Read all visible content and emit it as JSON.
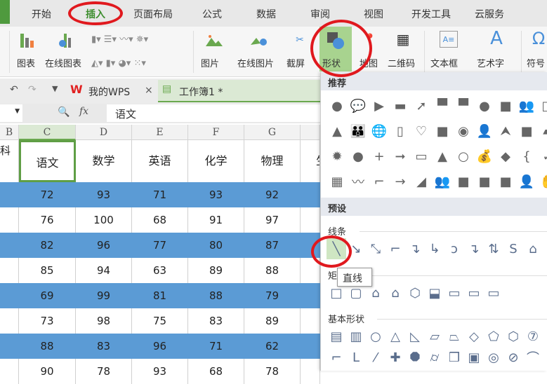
{
  "menu_tabs": [
    "开始",
    "插入",
    "页面布局",
    "公式",
    "数据",
    "审阅",
    "视图",
    "开发工具",
    "云服务"
  ],
  "active_tab": "插入",
  "ribbon": {
    "chart": "图表",
    "online_chart": "在线图表",
    "picture": "图片",
    "online_picture": "在线图片",
    "screenshot": "截屏",
    "shapes": "形状",
    "map": "地图",
    "qrcode": "二维码",
    "textbox": "文本框",
    "wordart": "艺术字",
    "symbol": "符号"
  },
  "doc_tabs": {
    "my_wps": "我的WPS",
    "workbook": "工作簿1 *"
  },
  "formula": {
    "fx": "fx",
    "value": "语文"
  },
  "columns": [
    "B",
    "C",
    "D",
    "E",
    "F",
    "G"
  ],
  "header_row": {
    "partial_b": "科",
    "cells": [
      "语文",
      "数学",
      "英语",
      "化学",
      "物理"
    ],
    "partial_h": "生"
  },
  "rows": [
    [
      "72",
      "93",
      "71",
      "93",
      "92"
    ],
    [
      "76",
      "100",
      "68",
      "91",
      "97"
    ],
    [
      "82",
      "96",
      "77",
      "80",
      "87"
    ],
    [
      "85",
      "94",
      "63",
      "89",
      "88"
    ],
    [
      "69",
      "99",
      "81",
      "88",
      "79"
    ],
    [
      "73",
      "98",
      "75",
      "83",
      "89"
    ],
    [
      "88",
      "83",
      "96",
      "71",
      "62"
    ],
    [
      "90",
      "78",
      "93",
      "68",
      "78"
    ]
  ],
  "colors": {
    "accent": "#4f9a3e",
    "band": "#5b9bd5",
    "annotation": "#e0191e"
  },
  "shapes_panel": {
    "recommended_title": "推荐",
    "recommended": [
      "●",
      "💬",
      "▶",
      "▬",
      "➚",
      "▀",
      "▀",
      "●",
      "■",
      "👥",
      "□",
      "▲",
      "👪",
      "🌐",
      "▯",
      "♡",
      "■",
      "◉",
      "👤",
      "⮝",
      "■",
      "▰",
      "✹",
      "●",
      "+",
      "➞",
      "▭",
      "▲",
      "○",
      "💰",
      "◆",
      "{",
      "✓",
      "▦",
      "〰",
      "⌐",
      "→",
      "◢",
      "👥",
      "■",
      "■",
      "■",
      "👤",
      "✋"
    ],
    "preset_title": "预设",
    "lines_label": "线条",
    "lines": [
      "╲",
      "↘",
      "⤡",
      "⌐",
      "↴",
      "↳",
      "ↄ",
      "↴",
      "⇅",
      "S",
      "⌂"
    ],
    "tooltip": "直线",
    "rect_label": "矩形",
    "rects": [
      "□",
      "▢",
      "⌂",
      "⌂",
      "⬡",
      "⬓",
      "▭",
      "▭",
      "▭"
    ],
    "basic_label": "基本形状",
    "basic": [
      "▤",
      "▥",
      "○",
      "△",
      "◺",
      "▱",
      "⏢",
      "◇",
      "⬠",
      "⬡",
      "⑦",
      "⌐",
      "L",
      "⁄",
      "✚",
      "⯃",
      "⌭",
      "❒",
      "▣",
      "◎",
      "⊘",
      "⌒"
    ]
  }
}
